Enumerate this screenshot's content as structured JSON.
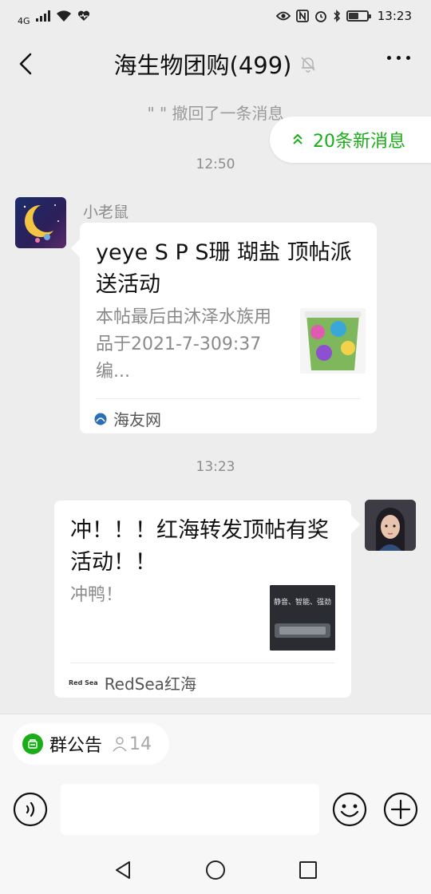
{
  "status_bar": {
    "network": "4G",
    "time": "13:23"
  },
  "header": {
    "title": "海生物团购(499)"
  },
  "recall_notice": "\"           \" 撤回了一条消息",
  "new_messages_label": "20条新消息",
  "messages": [
    {
      "timestamp": "12:50",
      "sender": "小老鼠",
      "title": "yeye S P S珊 瑚盐 顶帖派送活动",
      "description": "本帖最后由沐泽水族用品于2021-7-309:37编...",
      "source": "海友网"
    },
    {
      "timestamp": "13:23",
      "title": "冲！！！红海转发顶帖有奖活动！！",
      "description": "冲鸭！",
      "source": "RedSea红海",
      "source_logo_text": "Red Sea",
      "thumb_text": "静音、智能、强劲"
    }
  ],
  "notice": {
    "label": "群公告",
    "count": "14"
  },
  "colors": {
    "accent_green": "#1aad19",
    "background": "#ededed"
  },
  "icons": [
    "back-arrow-icon",
    "mute-bell-icon",
    "more-icon",
    "voice-icon",
    "emoji-icon",
    "plus-icon",
    "nav-back-icon",
    "nav-home-icon",
    "nav-recent-icon"
  ]
}
